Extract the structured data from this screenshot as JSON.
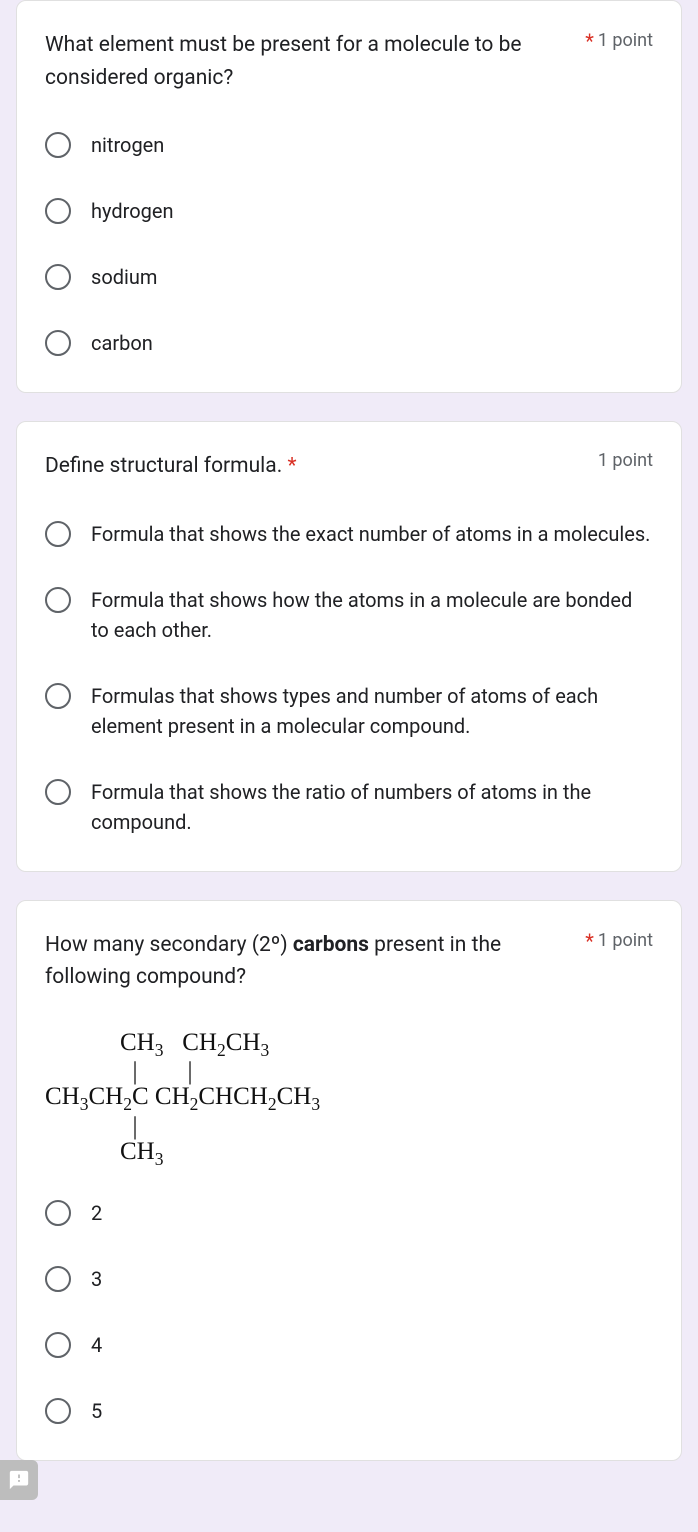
{
  "questions": [
    {
      "text": "What element must be present for a molecule to be considered organic?",
      "required": true,
      "points": "1 point",
      "options": [
        "nitrogen",
        "hydrogen",
        "sodium",
        "carbon"
      ]
    },
    {
      "text": "Define structural formula.",
      "required": true,
      "points": "1 point",
      "options": [
        "Formula that shows the exact number of atoms in a molecules.",
        "Formula that shows how the atoms in a molecule are bonded to each other.",
        "Formulas that shows types and number of atoms of each element present in a molecular compound.",
        "Formula that shows the ratio of numbers of atoms in the compound."
      ]
    },
    {
      "text_pre": "How many secondary (2º) ",
      "text_bold": "carbons",
      "text_post": " present in the following compound?",
      "required": true,
      "points": "1 point",
      "formula": {
        "row1_a": "CH",
        "row1_b": "CH",
        "row1_c": "CH",
        "row2_a": "CH",
        "row2_b": "CH",
        "row2_c": "C CH",
        "row2_d": "CHCH",
        "row2_e": "CH",
        "row3": "CH"
      },
      "options": [
        "2",
        "3",
        "4",
        "5"
      ]
    }
  ]
}
